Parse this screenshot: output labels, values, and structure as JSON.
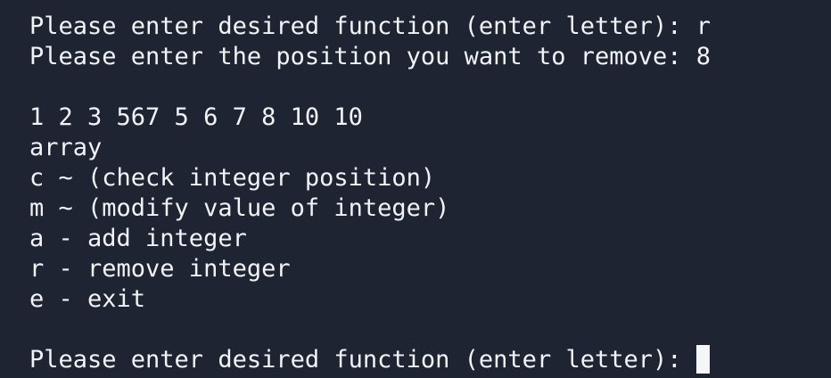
{
  "theme": {
    "background": "#1f2433",
    "foreground": "#f1f3f6",
    "cursor": "#f5f6f8"
  },
  "terminal": {
    "lines": [
      "Please enter desired function (enter letter): r",
      "Please enter the position you want to remove: 8",
      "",
      "1 2 3 567 5 6 7 8 10 10",
      "array",
      "c ~ (check integer position)",
      "m ~ (modify value of integer)",
      "a - add integer",
      "r - remove integer",
      "e - exit",
      ""
    ],
    "prompt": "Please enter desired function (enter letter): "
  }
}
